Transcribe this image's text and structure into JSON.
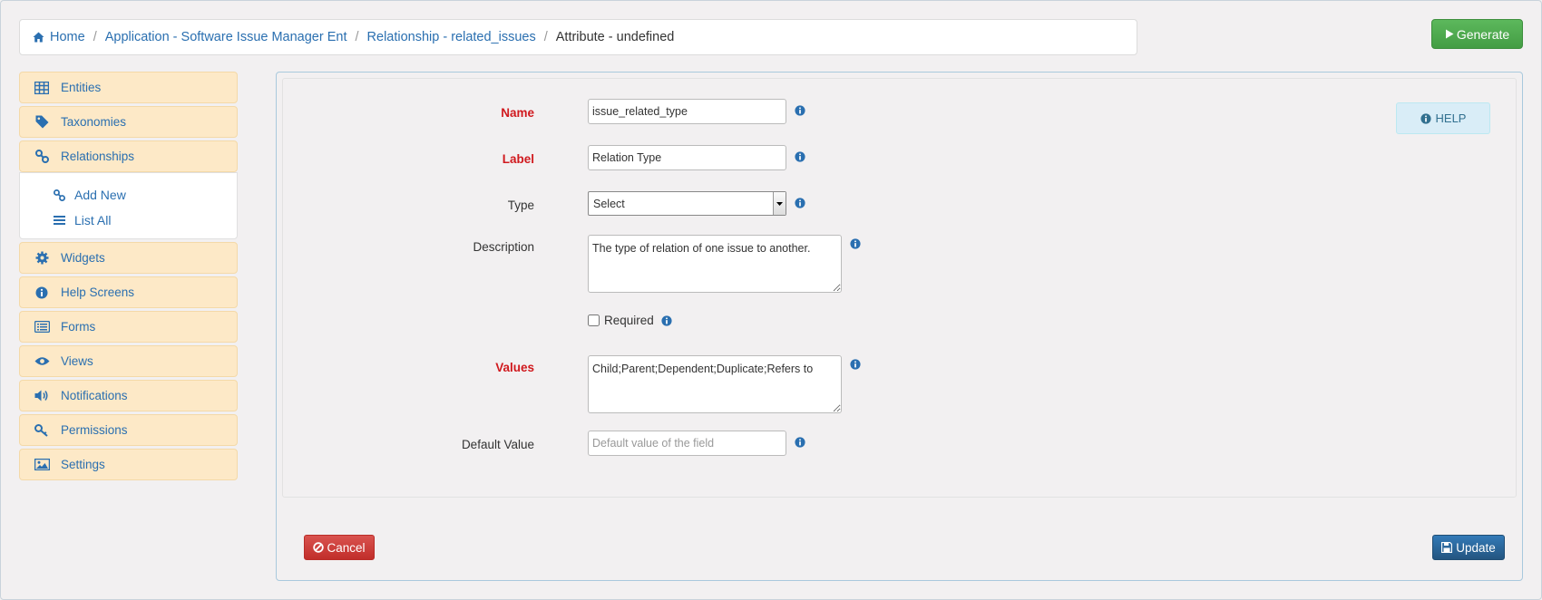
{
  "breadcrumb": {
    "home": "Home",
    "app": "Application - Software Issue Manager Ent",
    "relationship": "Relationship - related_issues",
    "current": "Attribute - undefined",
    "separator": "/"
  },
  "toolbar": {
    "generate_label": "Generate"
  },
  "sidebar": {
    "items": [
      {
        "label": "Entities",
        "icon": "table-icon"
      },
      {
        "label": "Taxonomies",
        "icon": "tag-icon"
      },
      {
        "label": "Relationships",
        "icon": "link-icon"
      },
      {
        "label": "Widgets",
        "icon": "gear-icon"
      },
      {
        "label": "Help Screens",
        "icon": "info-icon"
      },
      {
        "label": "Forms",
        "icon": "list-alt-icon"
      },
      {
        "label": "Views",
        "icon": "eye-icon"
      },
      {
        "label": "Notifications",
        "icon": "volume-icon"
      },
      {
        "label": "Permissions",
        "icon": "key-icon"
      },
      {
        "label": "Settings",
        "icon": "image-icon"
      }
    ],
    "submenu": [
      {
        "label": "Add New",
        "icon": "link-icon"
      },
      {
        "label": "List All",
        "icon": "list-icon"
      }
    ]
  },
  "form": {
    "name": {
      "label": "Name",
      "value": "issue_related_type"
    },
    "label": {
      "label": "Label",
      "value": "Relation Type"
    },
    "type": {
      "label": "Type",
      "value": "Select"
    },
    "description": {
      "label": "Description",
      "value": "The type of relation of one issue to another."
    },
    "required": {
      "label": "Required"
    },
    "values": {
      "label": "Values",
      "value": "Child;Parent;Dependent;Duplicate;Refers to"
    },
    "default_value": {
      "label": "Default Value",
      "placeholder": "Default value of the field"
    }
  },
  "buttons": {
    "help": "HELP",
    "cancel": "Cancel",
    "update": "Update"
  },
  "colors": {
    "link": "#2a6fb0",
    "required": "#d0191e",
    "sidebar_bg": "#fde9c7",
    "generate": "#5cb85c",
    "cancel": "#d9534f",
    "update": "#337ab7"
  }
}
